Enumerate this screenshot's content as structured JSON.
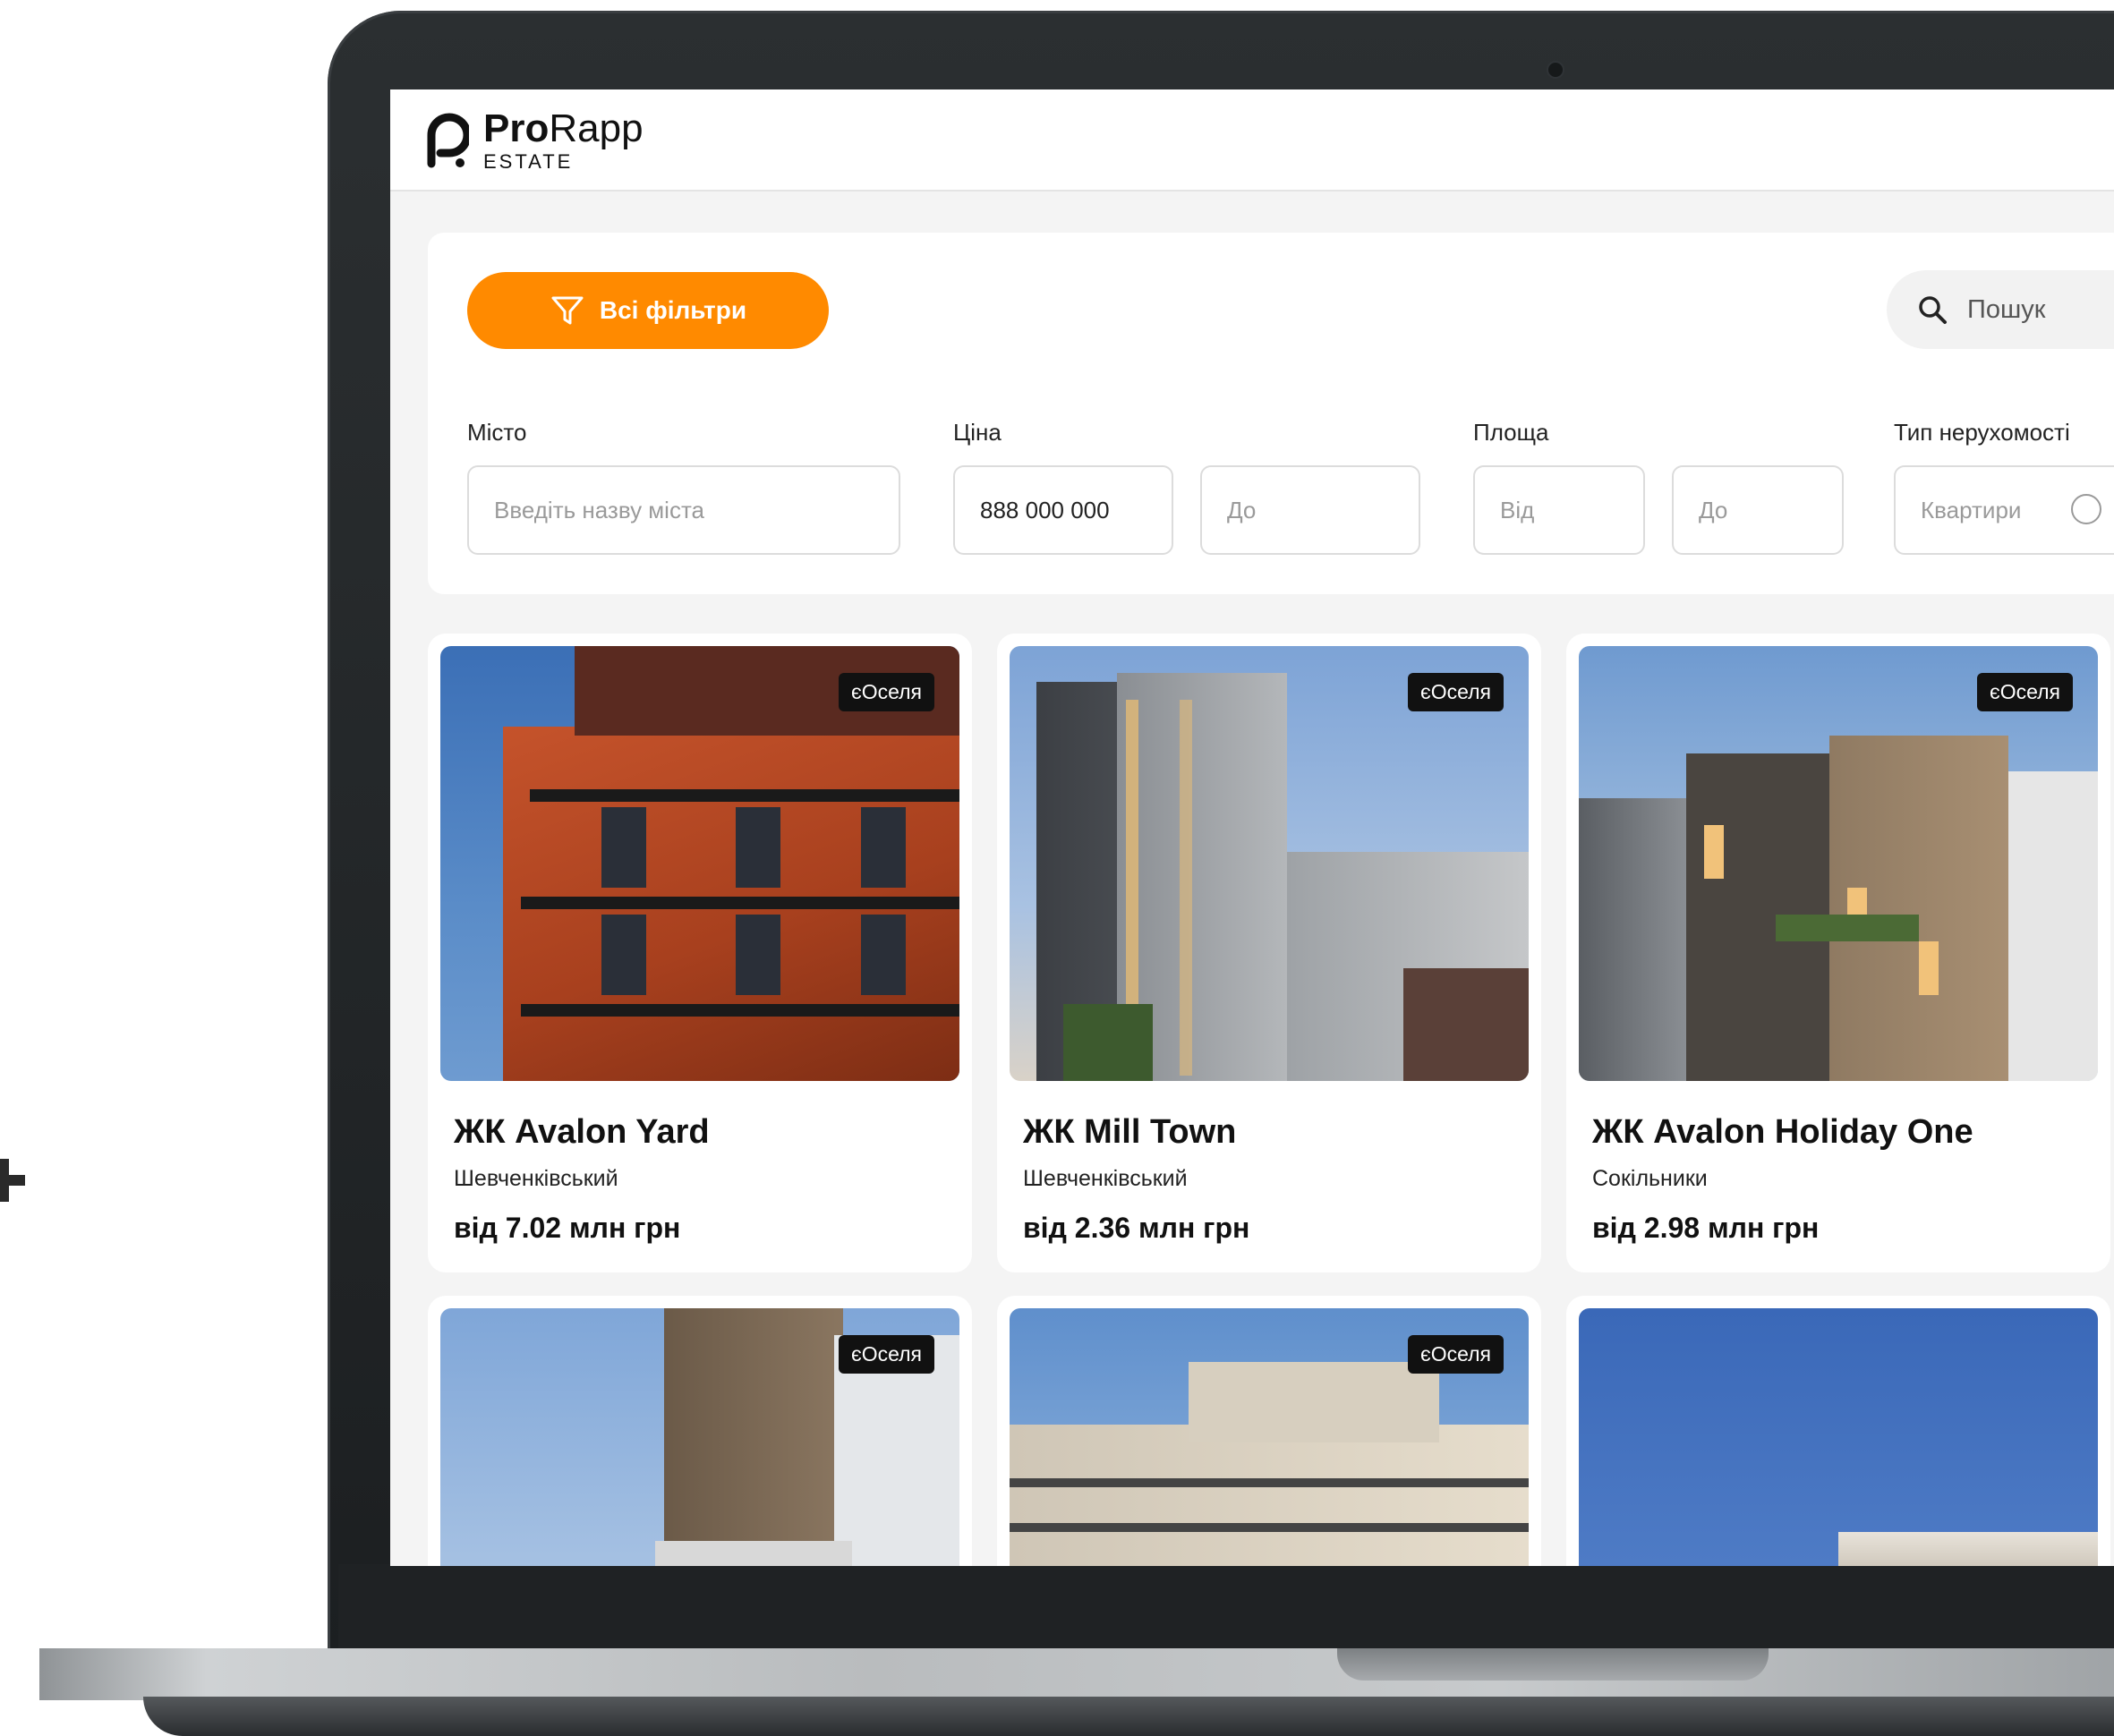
{
  "brand": {
    "name_bold": "Pro",
    "name_light": "Rapp",
    "subtitle": "ESTATE"
  },
  "filters": {
    "all_filters_label": "Всі фільтри",
    "search_placeholder": "Пошук",
    "city": {
      "label": "Місто",
      "placeholder": "Введіть назву міста"
    },
    "price": {
      "label": "Ціна",
      "from_value": "888 000 000",
      "to_placeholder": "До"
    },
    "area": {
      "label": "Площа",
      "from_placeholder": "Від",
      "to_placeholder": "До"
    },
    "property_type": {
      "label": "Тип нерухомості",
      "placeholder": "Квартири"
    }
  },
  "listings": [
    {
      "badge": "єОселя",
      "title": "ЖК Avalon Yard",
      "district": "Шевченківський",
      "price": "від 7.02 млн грн"
    },
    {
      "badge": "єОселя",
      "title": "ЖК Mill Town",
      "district": "Шевченківський",
      "price": "від 2.36 млн грн"
    },
    {
      "badge": "єОселя",
      "title": "ЖК Avalon Holiday One",
      "district": "Сокільники",
      "price": "від 2.98 млн грн"
    },
    {
      "badge": "єОселя"
    },
    {
      "badge": "єОселя"
    },
    {}
  ],
  "colors": {
    "accent": "#ff8a00",
    "badge_bg": "#111111",
    "screen_bg": "#f4f4f4"
  },
  "icons": {
    "filter": "funnel-icon",
    "search": "search-icon",
    "logo": "prorapp-logo-icon"
  }
}
